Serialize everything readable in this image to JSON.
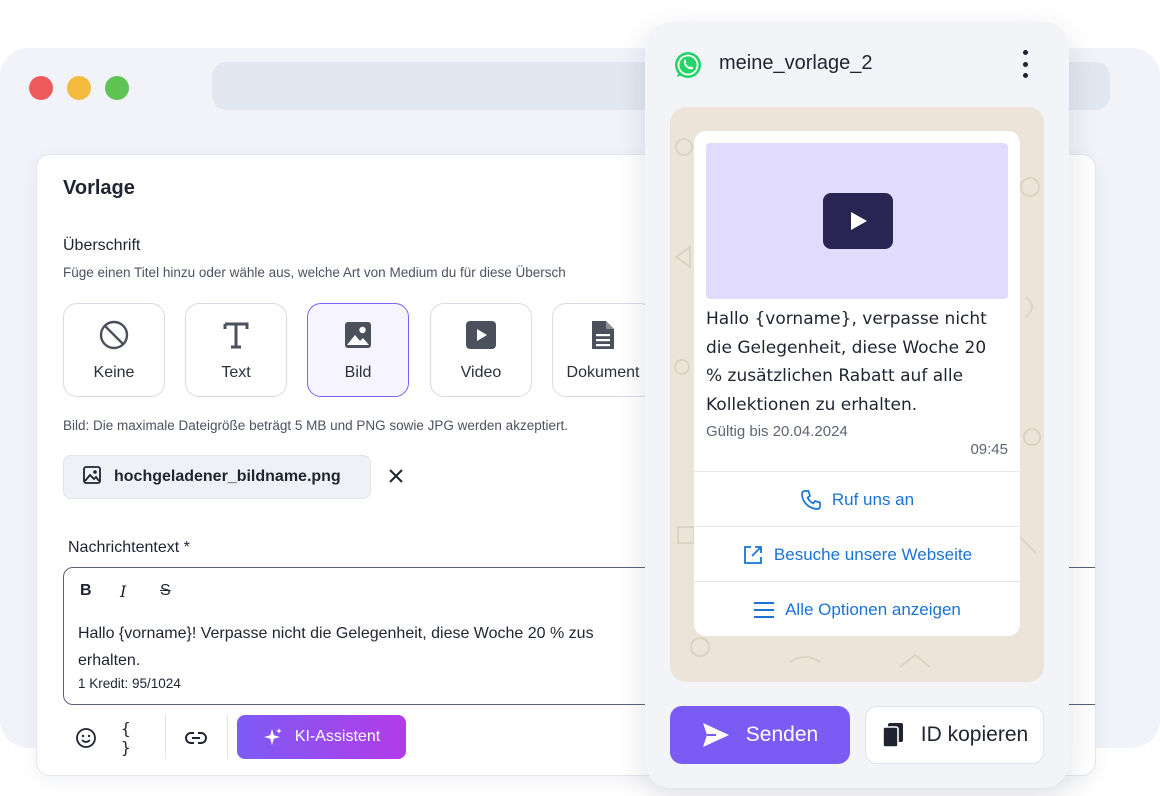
{
  "form": {
    "title": "Vorlage",
    "header_section": {
      "label": "Überschrift",
      "help": "Füge einen Titel hinzu oder wähle aus, welche Art von Medium du für diese Übersch"
    },
    "media_types": [
      {
        "label": "Keine",
        "icon": "no-media-icon"
      },
      {
        "label": "Text",
        "icon": "text-icon"
      },
      {
        "label": "Bild",
        "icon": "image-icon",
        "selected": true
      },
      {
        "label": "Video",
        "icon": "video-icon"
      },
      {
        "label": "Dokument",
        "icon": "document-icon"
      }
    ],
    "image_hint": "Bild: Die maximale Dateigröße beträgt 5 MB und PNG sowie JPG werden akzeptiert.",
    "uploaded_file": "hochgeladener_bildname.png",
    "message": {
      "label": "Nachrichtentext *",
      "text": "Hallo {vorname}! Verpasse nicht die Gelegenheit, diese Woche 20 % zus",
      "text_line2": "erhalten.",
      "counter": "1 Kredit: 95/1024",
      "format_bold": "B",
      "format_italic": "I",
      "format_strike": "S"
    },
    "toolbar": {
      "variables": "{ }",
      "ai_label": "KI-Assistent"
    }
  },
  "preview": {
    "template_name": "meine_vorlage_2",
    "body": "Hallo {vorname}, verpasse nicht die Gelegenheit, diese Woche 20 % zusätzlichen Rabatt auf alle Kollektionen zu erhalten.",
    "footer": "Gültig bis 20.04.2024",
    "time": "09:45",
    "buttons": [
      {
        "label": "Ruf uns an",
        "icon": "phone-icon"
      },
      {
        "label": "Besuche unsere Webseite",
        "icon": "external-link-icon"
      },
      {
        "label": "Alle Optionen anzeigen",
        "icon": "list-icon"
      }
    ],
    "send_label": "Senden",
    "copy_label": "ID kopieren"
  },
  "colors": {
    "accent": "#7a5cf4",
    "link": "#1a73d6",
    "whatsapp": "#25d366",
    "chat_background": "#ece4d8"
  }
}
